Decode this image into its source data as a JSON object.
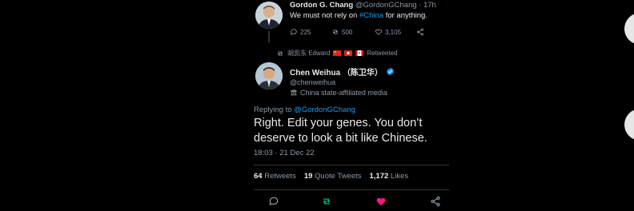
{
  "parent_tweet": {
    "author_name": "Gordon G. Chang",
    "author_handle": "@GordonGChang",
    "separator": "·",
    "time": "17h",
    "text_before": "We must not rely on ",
    "hashtag": "#China",
    "text_after": " for anything.",
    "replies": "225",
    "retweets": "500",
    "likes": "3,105"
  },
  "retweet_banner": {
    "retweeter": "胡凯东 Edward",
    "action": "Retweeted"
  },
  "main_tweet": {
    "author_name": "Chen Weihua （陈卫华）",
    "author_handle": "@chenweihua",
    "affiliation_label": "China state-affiliated media",
    "replying_to_prefix": "Replying to ",
    "replying_to_handle": "@GordonGChang",
    "text": "Right. Edit your genes. You don’t deserve to look a bit like Chinese.",
    "timestamp": "18:03 · 21 Dec 22",
    "retweets_count": "64",
    "retweets_label": "Retweets",
    "quote_count": "19",
    "quote_label": "Quote Tweets",
    "likes_count": "1,172",
    "likes_label": "Likes"
  },
  "icons": [
    "reply-icon",
    "retweet-icon",
    "like-icon",
    "share-icon",
    "verified-icon",
    "state-media-icon"
  ],
  "colors": {
    "accent": "#1d9bf0",
    "retweet_active": "#00ba7c",
    "like_active": "#f91880",
    "muted": "#8b98a5",
    "background": "#000000"
  }
}
